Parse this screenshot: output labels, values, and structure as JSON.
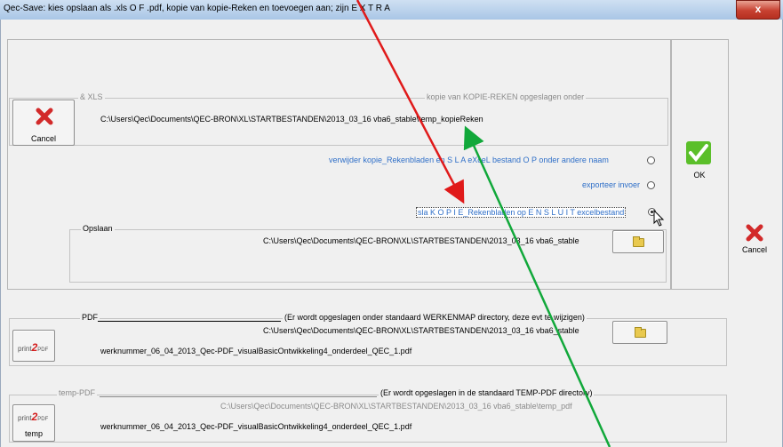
{
  "window": {
    "title": "Qec-Save:    kies opslaan als .xls  O F .pdf, kopie van kopie-Reken en toevoegen aan; zijn E X T R A",
    "close_glyph": "x"
  },
  "xls_group": {
    "label": "& XLS",
    "caption": "kopie van KOPIE-REKEN opgeslagen onder",
    "path": "C:\\Users\\Qec\\Documents\\QEC-BRON\\XL\\STARTBESTANDEN\\2013_03_16 vba6_stable\\temp_kopieReken",
    "cancel_label": "Cancel"
  },
  "options": [
    {
      "label": "verwijder kopie_Rekenbladen en S L A eXceL bestand O P onder andere naam",
      "selected": false
    },
    {
      "label": "exporteer invoer",
      "selected": false
    },
    {
      "label": "sla K O P I E_Rekenbladen op E N  S L U I T excelbestand",
      "selected": true
    }
  ],
  "ok_label": "OK",
  "cancel_label": "Cancel",
  "opslaan": {
    "label": "Opslaan",
    "path": "C:\\Users\\Qec\\Documents\\QEC-BRON\\XL\\STARTBESTANDEN\\2013_03_16 vba6_stable"
  },
  "pdf_group": {
    "label": "PDF",
    "note": "(Er wordt opgeslagen onder standaard WERKENMAP directory, deze evt te wijzigen)",
    "path": "C:\\Users\\Qec\\Documents\\QEC-BRON\\XL\\STARTBESTANDEN\\2013_03_16 vba6_stable",
    "filename": "werknummer_06_04_2013_Qec-PDF_visualBasicOntwikkeling4_onderdeel_QEC_1.pdf",
    "print_prefix": "print",
    "print_logo": "2",
    "print_suffix": "PDF"
  },
  "temp_pdf_group": {
    "label": "temp-PDF",
    "note": "(Er wordt opgeslagen in de standaard TEMP-PDF directory)",
    "path": "C:\\Users\\Qec\\Documents\\QEC-BRON\\XL\\STARTBESTANDEN\\2013_03_16 vba6_stable\\temp_pdf",
    "filename": "werknummer_06_04_2013_Qec-PDF_visualBasicOntwikkeling4_onderdeel_QEC_1.pdf",
    "print_prefix": "print",
    "print_logo": "2",
    "print_suffix": "PDF",
    "button_label": "temp"
  },
  "colors": {
    "accent_blue": "#2f6fc8",
    "ok_green": "#5bbf2a",
    "cancel_red": "#d22a2a",
    "arrow_red": "#e01a1a",
    "arrow_green": "#11a83a"
  }
}
